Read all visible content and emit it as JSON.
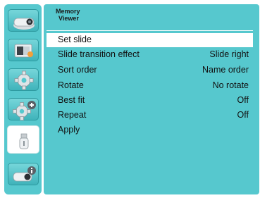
{
  "header": {
    "crumb_line1": "Memory",
    "crumb_line2": "Viewer"
  },
  "sidebar": {
    "items": [
      {
        "icon": "projector-icon"
      },
      {
        "icon": "picture-adjust-icon"
      },
      {
        "icon": "gear-icon"
      },
      {
        "icon": "gear-plus-icon"
      },
      {
        "icon": "usb-drive-icon",
        "active": true
      },
      {
        "icon": "projector-info-icon"
      }
    ]
  },
  "menu": {
    "rows": [
      {
        "label": "Set slide",
        "value": ""
      },
      {
        "label": "Slide transition effect",
        "value": "Slide right"
      },
      {
        "label": "Sort order",
        "value": "Name order"
      },
      {
        "label": "Rotate",
        "value": "No rotate"
      },
      {
        "label": "Best fit",
        "value": "Off"
      },
      {
        "label": "Repeat",
        "value": "Off"
      },
      {
        "label": "Apply",
        "value": ""
      }
    ],
    "selected_index": 0
  },
  "colors": {
    "panel": "#56c8ce",
    "highlight": "#ffffff",
    "text": "#111111"
  }
}
